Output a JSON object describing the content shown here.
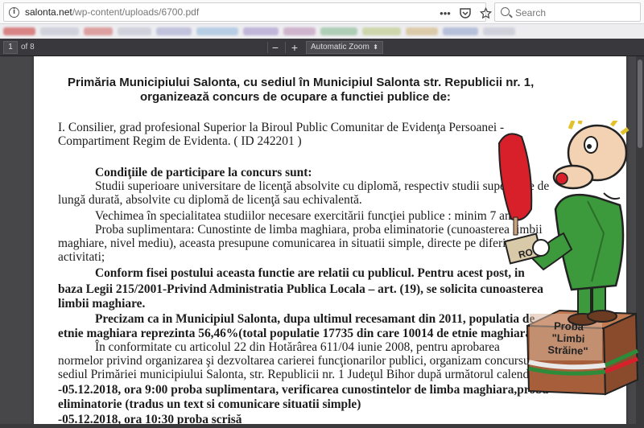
{
  "browser": {
    "url_domain": "salonta.net",
    "url_path": "/wp-content/uploads/6700.pdf",
    "search_placeholder": "Search",
    "actions": [
      "more-actions",
      "pocket",
      "bookmark-star"
    ]
  },
  "pdf_toolbar": {
    "page_current": "1",
    "page_total": "of 8",
    "zoom_out": "−",
    "zoom_in": "+",
    "zoom_value": "Automatic Zoom"
  },
  "document": {
    "heading1": "Primăria Municipiului Salonta, cu sediul în Municipiul Salonta str. Republicii nr. 1,",
    "heading2": "organizează concurs de ocupare a functiei publice de:",
    "l1": "I. Consilier, grad  profesional Superior la Biroul Public Comunitar de Evidenţa Persoanei -",
    "l2": "Compartiment Regim de Evidenta.  ( ID 242201 )",
    "l3": "Condiţiile  de participare la concurs sunt:",
    "l4": "Studii superioare  universitare de licenţă absolvite cu diplomă, respectiv studii superioare de",
    "l5": "lungă durată, absolvite cu diplomă de licenţă sau echivalentă.",
    "l6": "Vechimea în specialitatea studiilor necesare exercitării funcţiei publice : minim 7 ani",
    "l7": "Proba suplimentara: Cunostinte de limba maghiara, proba eliminatorie (cunoasterea limbii",
    "l8": "maghiare, nivel mediu), aceasta presupune comunicarea in situatii simple, directe pe diferite",
    "l9": "activitati;",
    "l10": "Conform fisei postului aceasta functie are relatii cu publicul. Pentru acest post, in",
    "l11": "baza Legii 215/2001-Privind Administratia Publica Locala – art. (19), se solicita cunoasterea",
    "l12": "limbii maghiare.",
    "l13": "Precizam ca in Municipiul Salonta, dupa ultimul recesamant din 2011, populatia de",
    "l14": "etnie maghiara reprezinta 56,46%(total populatie 17735 din care 10014 de etnie maghiara).",
    "l15": "În conformitate cu    articolul 22     din Hotărârea 611/04 iunie 2008, pentru aprobarea",
    "l16": "normelor privind organizarea şi dezvoltarea carierei funcţionarilor publici,  organizam concursul la",
    "l17": "sediul  Primăriei municipiului Salonta, str. Republicii nr. 1 Judeţul Bihor după următorul calendar:",
    "l18": "-05.12.2018, ora 9:00 proba suplimentara, verificarea cunostintelor de limba maghiara,proba",
    "l19": "eliminatorie (tradus un text si comunicare situatii simple)",
    "l20": "-05.12.2018, ora 10:30 proba scrisă"
  },
  "cartoon": {
    "box_text": [
      "Proba",
      "\"Limbi",
      "Străine\""
    ],
    "label_ro": "RO"
  },
  "colors": {
    "toolbar_bg": "#38383d",
    "viewer_bg": "#474749",
    "cartoon_green": "#3c9a3c",
    "cartoon_red": "#d8202a",
    "box_brown": "#a65f3a"
  }
}
